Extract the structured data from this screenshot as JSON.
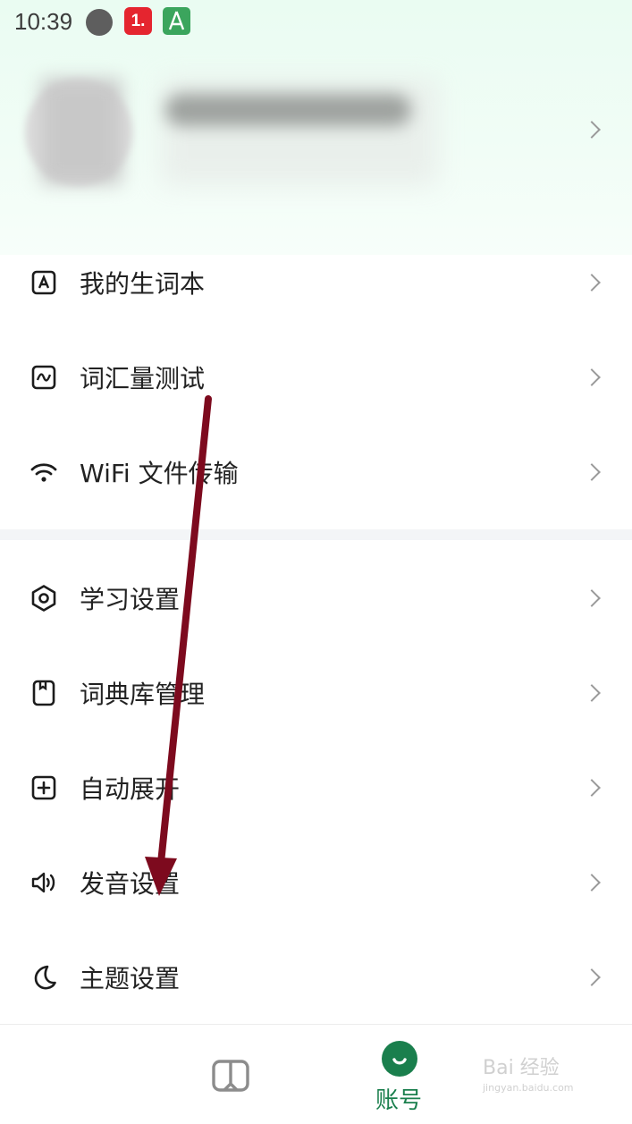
{
  "status_bar": {
    "time": "10:39",
    "app_badge_text": "1."
  },
  "menu_group_1": [
    {
      "label": "我的生词本",
      "icon": "vocabulary-book-icon"
    },
    {
      "label": "词汇量测试",
      "icon": "vocab-test-chart-icon"
    },
    {
      "label": "WiFi 文件传输",
      "icon": "wifi-icon"
    }
  ],
  "menu_group_2": [
    {
      "label": "学习设置",
      "icon": "hexagon-settings-icon"
    },
    {
      "label": "词典库管理",
      "icon": "dictionary-icon"
    },
    {
      "label": "自动展开",
      "icon": "plus-square-icon"
    },
    {
      "label": "发音设置",
      "icon": "speaker-icon"
    },
    {
      "label": "主题设置",
      "icon": "moon-icon"
    }
  ],
  "bottom_nav": {
    "account_label": "账号"
  },
  "watermark": {
    "text": "Bai 经验",
    "url_text": "jingyan.baidu.com"
  },
  "colors": {
    "accent": "#1a7f4d",
    "annotation_arrow": "#7d0a1e"
  }
}
